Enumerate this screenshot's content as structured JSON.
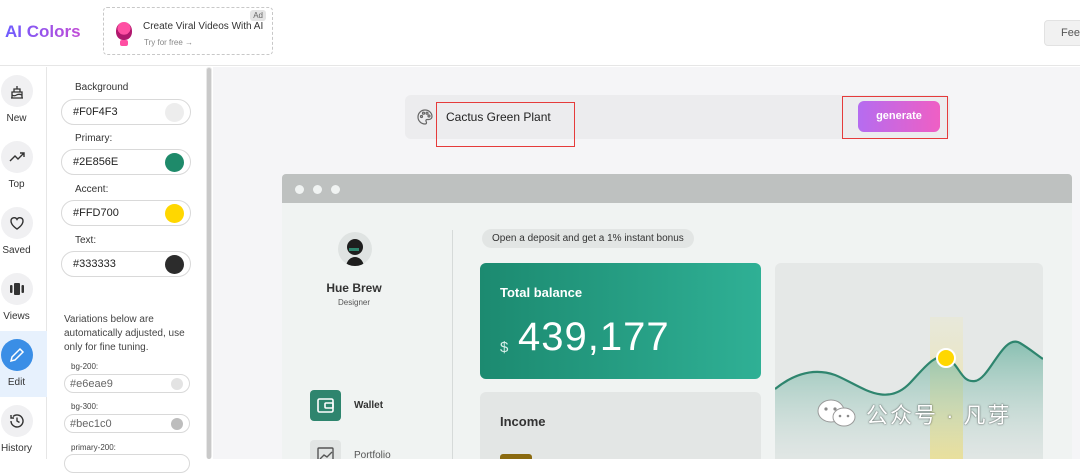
{
  "app": {
    "logo": "AI Colors",
    "feedback_label": "Feed"
  },
  "ad": {
    "badge": "Ad",
    "title": "Create Viral Videos With AI",
    "subtitle": "Try for free →"
  },
  "rail": {
    "items": [
      {
        "label": "New",
        "icon": "cake-icon"
      },
      {
        "label": "Top",
        "icon": "trending-icon"
      },
      {
        "label": "Saved",
        "icon": "heart-icon"
      },
      {
        "label": "Views",
        "icon": "carousel-icon"
      },
      {
        "label": "Edit",
        "icon": "pencil-icon",
        "active": true
      },
      {
        "label": "History",
        "icon": "history-icon"
      }
    ]
  },
  "panel": {
    "colors": [
      {
        "label": "Background",
        "value": "#F0F4F3",
        "swatch": "#ededed"
      },
      {
        "label": "Primary:",
        "value": "#2E856E",
        "swatch": "#1e8a6a"
      },
      {
        "label": "Accent:",
        "value": "#FFD700",
        "swatch": "#ffd700"
      },
      {
        "label": "Text:",
        "value": "#333333",
        "swatch": "#2c2c2c"
      }
    ],
    "variation_note": "Variations below are automatically adjusted, use only for fine tuning.",
    "variations": [
      {
        "label": "bg-200:",
        "value": "#e6eae9",
        "swatch": "#e3e3e3"
      },
      {
        "label": "bg-300:",
        "value": "#bec1c0",
        "swatch": "#bdbdbd"
      },
      {
        "label": "primary-200:",
        "value": "",
        "swatch": "#2E856E"
      }
    ]
  },
  "prompt": {
    "value": "Cactus Green Plant",
    "generate_label": "generate"
  },
  "preview": {
    "user_name": "Hue Brew",
    "user_role": "Designer",
    "nav": [
      {
        "label": "Wallet"
      },
      {
        "label": "Portfolio"
      }
    ],
    "promo": "Open a deposit and get a 1% instant bonus",
    "balance_title": "Total balance",
    "balance_currency": "$",
    "balance_value": "439,177",
    "income_title": "Income",
    "colors": {
      "primary": "#2E856E",
      "accent": "#FFD700",
      "bg": "#F0F4F3",
      "bg300": "#bec1c0"
    }
  },
  "watermark": {
    "text": "公众号 · 凡芽"
  }
}
